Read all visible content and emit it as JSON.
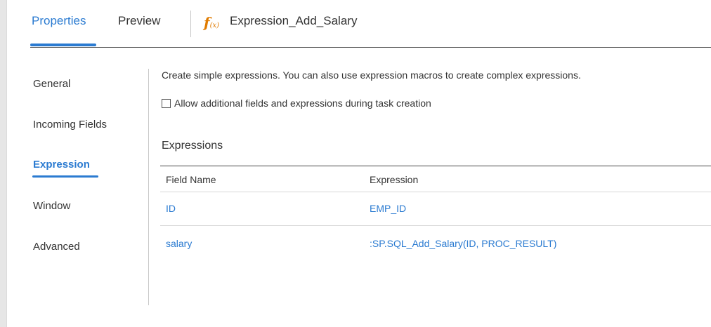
{
  "header": {
    "tabs": [
      {
        "label": "Properties",
        "active": true
      },
      {
        "label": "Preview",
        "active": false
      }
    ],
    "object_icon": "fx-icon",
    "object_icon_text": {
      "f": "f",
      "x": "(x)"
    },
    "object_name": "Expression_Add_Salary"
  },
  "sidebar": {
    "items": [
      {
        "label": "General",
        "active": false
      },
      {
        "label": "Incoming Fields",
        "active": false
      },
      {
        "label": "Expression",
        "active": true
      },
      {
        "label": "Window",
        "active": false
      },
      {
        "label": "Advanced",
        "active": false
      }
    ]
  },
  "content": {
    "description": "Create simple expressions. You can also use expression macros to create complex expressions.",
    "allow_additional": {
      "label": "Allow additional fields and expressions during task creation",
      "checked": false
    },
    "section_title": "Expressions",
    "table": {
      "columns": [
        "Field Name",
        "Expression"
      ],
      "rows": [
        {
          "field": "ID",
          "expression": "EMP_ID"
        },
        {
          "field": "salary",
          "expression": ":SP.SQL_Add_Salary(ID, PROC_RESULT)"
        }
      ]
    }
  },
  "colors": {
    "accent": "#2b7bd1",
    "fx_icon": "#e07b00",
    "text": "#333333"
  }
}
